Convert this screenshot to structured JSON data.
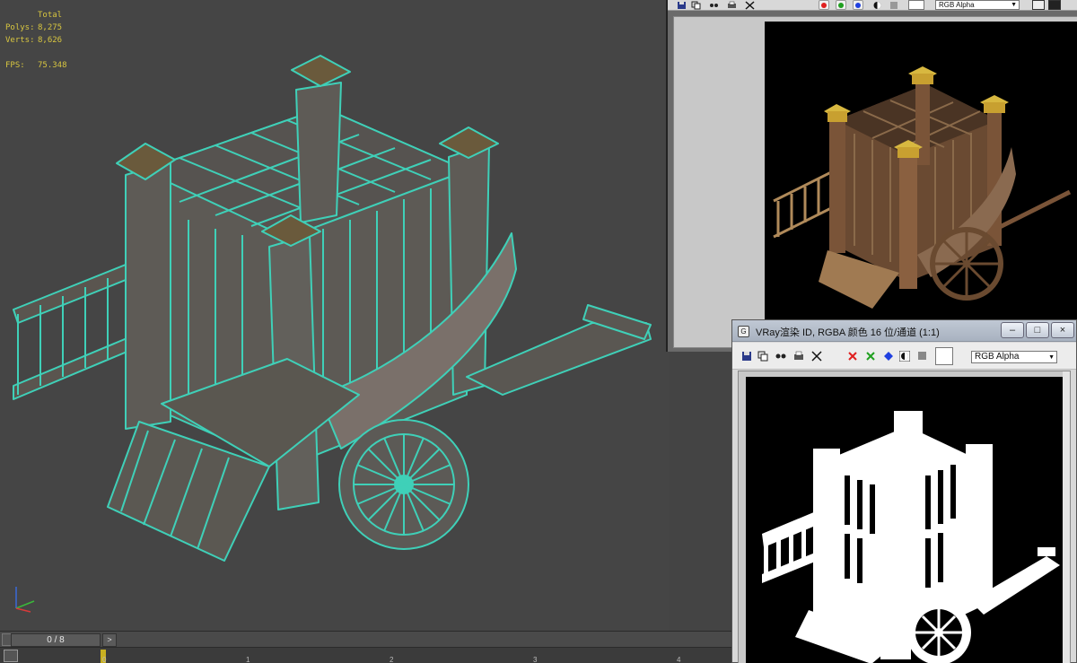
{
  "viewport": {
    "stats": {
      "total_label": "Total",
      "polys_label": "Polys:",
      "polys_value": "8,275",
      "verts_label": "Verts:",
      "verts_value": "8,626",
      "fps_label": "FPS:",
      "fps_value": "75.348"
    },
    "wire_color": "#3fd0b8"
  },
  "timeline": {
    "frame_counter": "0 / 8",
    "next_symbol": ">",
    "ticks": [
      "0",
      "1",
      "2",
      "3",
      "4"
    ]
  },
  "render_window": {
    "channel_select": "RGB Alpha"
  },
  "render_window2": {
    "title": "VRay渲染 ID, RGBA 颜色 16 位/通道 (1:1)",
    "app_icon": "G",
    "minimize": "–",
    "maximize": "□",
    "close": "×",
    "channel_select": "RGB Alpha"
  },
  "colors": {
    "red_channel": "#e02020",
    "green_channel": "#20a020",
    "blue_channel": "#2040e0",
    "accent_yellow": "#d8c640"
  },
  "icons": [
    "save-icon",
    "copy-icon",
    "clone-icon",
    "print-icon",
    "clear-icon",
    "red-channel-icon",
    "green-channel-icon",
    "blue-channel-icon",
    "mono-icon",
    "alpha-icon",
    "swatch-icon"
  ]
}
